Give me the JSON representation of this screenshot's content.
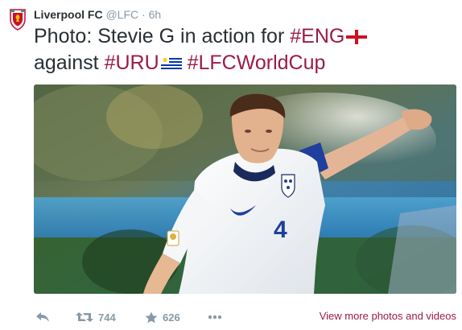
{
  "tweet": {
    "author_name": "Liverpool FC",
    "handle": "@LFC",
    "separator": "·",
    "time": "6h",
    "text_segments": [
      {
        "text": "Photo: Stevie G in action for ",
        "type": "plain"
      },
      {
        "text": "#ENG",
        "type": "hashtag"
      },
      {
        "text": "",
        "type": "flag",
        "flag": "england"
      },
      {
        "text": " against ",
        "type": "plain"
      },
      {
        "text": "#URU",
        "type": "hashtag"
      },
      {
        "text": "",
        "type": "flag",
        "flag": "uruguay"
      },
      {
        "text": " ",
        "type": "plain"
      },
      {
        "text": "#LFCWorldCup",
        "type": "hashtag"
      }
    ],
    "hashtag_color": "#9b1b44",
    "photo": {
      "subject": "footballer in white kit number 4",
      "shirt_number": "4"
    }
  },
  "actions": {
    "reply_icon": "reply-icon",
    "retweet_icon": "retweet-icon",
    "retweet_count": "744",
    "favorite_icon": "star-icon",
    "favorite_count": "626",
    "more_icon": "more-icon",
    "view_more_label": "View more photos and videos"
  },
  "colors": {
    "text": "#292f33",
    "muted": "#8899a6",
    "accent": "#9b1b44"
  }
}
